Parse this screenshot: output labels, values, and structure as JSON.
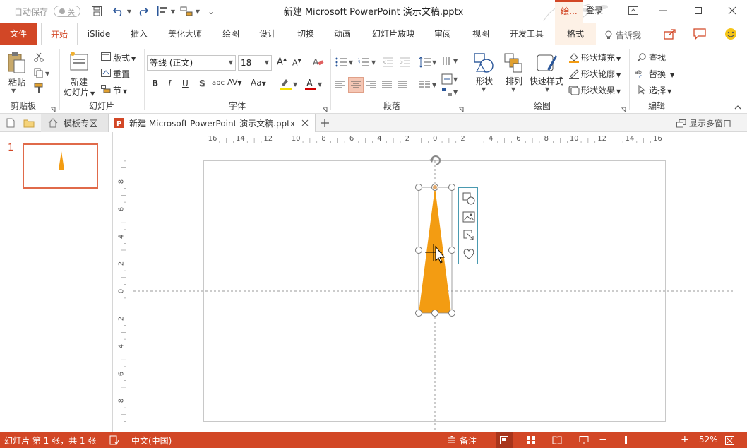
{
  "titlebar": {
    "autosave_label": "自动保存",
    "autosave_state": "关",
    "title": "新建 Microsoft PowerPoint 演示文稿.pptx",
    "context_tab": "绘...",
    "login": "登录"
  },
  "tabs": [
    "文件",
    "开始",
    "iSlide",
    "插入",
    "美化大师",
    "绘图",
    "设计",
    "切换",
    "动画",
    "幻灯片放映",
    "审阅",
    "视图",
    "开发工具",
    "格式"
  ],
  "tell_me": "告诉我",
  "ribbon": {
    "clipboard": {
      "paste": "粘贴",
      "label": "剪贴板"
    },
    "slides": {
      "new_slide_1": "新建",
      "new_slide_2": "幻灯片",
      "layout": "版式",
      "reset": "重置",
      "section": "节",
      "label": "幻灯片"
    },
    "font": {
      "font_name": "等线 (正文)",
      "font_size": "18",
      "label": "字体"
    },
    "paragraph": {
      "label": "段落"
    },
    "drawing": {
      "shapes": "形状",
      "arrange": "排列",
      "quick_styles": "快速样式",
      "fill": "形状填充",
      "outline": "形状轮廓",
      "effects": "形状效果",
      "label": "绘图"
    },
    "editing": {
      "find": "查找",
      "replace": "替换",
      "select": "选择",
      "label": "编辑"
    }
  },
  "doctabs": {
    "template_tab": "模板专区",
    "doc_tab": "新建 Microsoft PowerPoint 演示文稿.pptx",
    "show_multi": "显示多窗口"
  },
  "thumbnails": {
    "slide_number": "1"
  },
  "ruler": {
    "h_ticks": [
      "16",
      "14",
      "12",
      "10",
      "8",
      "6",
      "4",
      "2",
      "0",
      "2",
      "4",
      "6",
      "8",
      "10",
      "12",
      "14",
      "16"
    ],
    "v_ticks": [
      "8",
      "6",
      "4",
      "2",
      "0",
      "2",
      "4",
      "6",
      "8"
    ]
  },
  "shape": {
    "fill": "#f39c12"
  },
  "status": {
    "slide_info": "幻灯片 第 1 张，共 1 张",
    "language": "中文(中国)",
    "notes": "备注",
    "zoom": "52%"
  },
  "colors": {
    "accent": "#d24726",
    "context_tab_bg": "#fdf1e6",
    "selection": "#f5c6b4"
  }
}
